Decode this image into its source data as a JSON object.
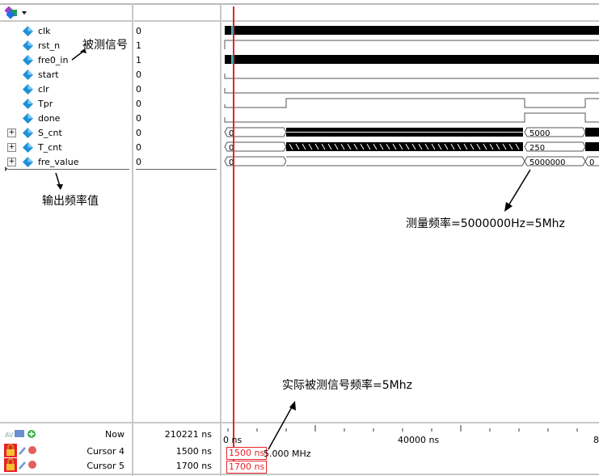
{
  "toolbar": {
    "icon": "wave-app-icon",
    "dropdown": "chevron-down-icon"
  },
  "signals": [
    {
      "name": "clk",
      "value": "0",
      "expandable": false
    },
    {
      "name": "rst_n",
      "value": "1",
      "expandable": false
    },
    {
      "name": "fre0_in",
      "value": "1",
      "expandable": false
    },
    {
      "name": "start",
      "value": "0",
      "expandable": false
    },
    {
      "name": "clr",
      "value": "0",
      "expandable": false
    },
    {
      "name": "Tpr",
      "value": "0",
      "expandable": false
    },
    {
      "name": "done",
      "value": "0",
      "expandable": false
    },
    {
      "name": "S_cnt",
      "value": "0",
      "expandable": true
    },
    {
      "name": "T_cnt",
      "value": "0",
      "expandable": true
    },
    {
      "name": "fre_value",
      "value": "0",
      "expandable": true
    }
  ],
  "bus_values": {
    "S_cnt": {
      "start": "0",
      "end": "5000"
    },
    "T_cnt": {
      "start": "0",
      "end": "250"
    },
    "fre_value": {
      "start": "0",
      "end": "5000000",
      "after": "0"
    }
  },
  "annotations": {
    "measured_signal": "被测信号",
    "output_freq": "输出频率值",
    "measured_freq": "测量频率=5000000Hz=5Mhz",
    "actual_freq": "实际被测信号频率=5Mhz"
  },
  "cursors": {
    "now": {
      "label": "Now",
      "value": "210221 ns"
    },
    "cursor4": {
      "label": "Cursor 4",
      "value": "1500 ns"
    },
    "cursor5": {
      "label": "Cursor 5",
      "value": "1700 ns"
    }
  },
  "timeline": {
    "tick_start": "0 ns",
    "tick_mid": "40000 ns",
    "tick_end": "8",
    "cursor4_box": "1500 ns",
    "cursor5_box": "1700 ns",
    "delta_freq": "5.000 MHz"
  },
  "colors": {
    "cursor": "#e8232a",
    "signal": "#000000",
    "diamond": "#1e90d8"
  }
}
